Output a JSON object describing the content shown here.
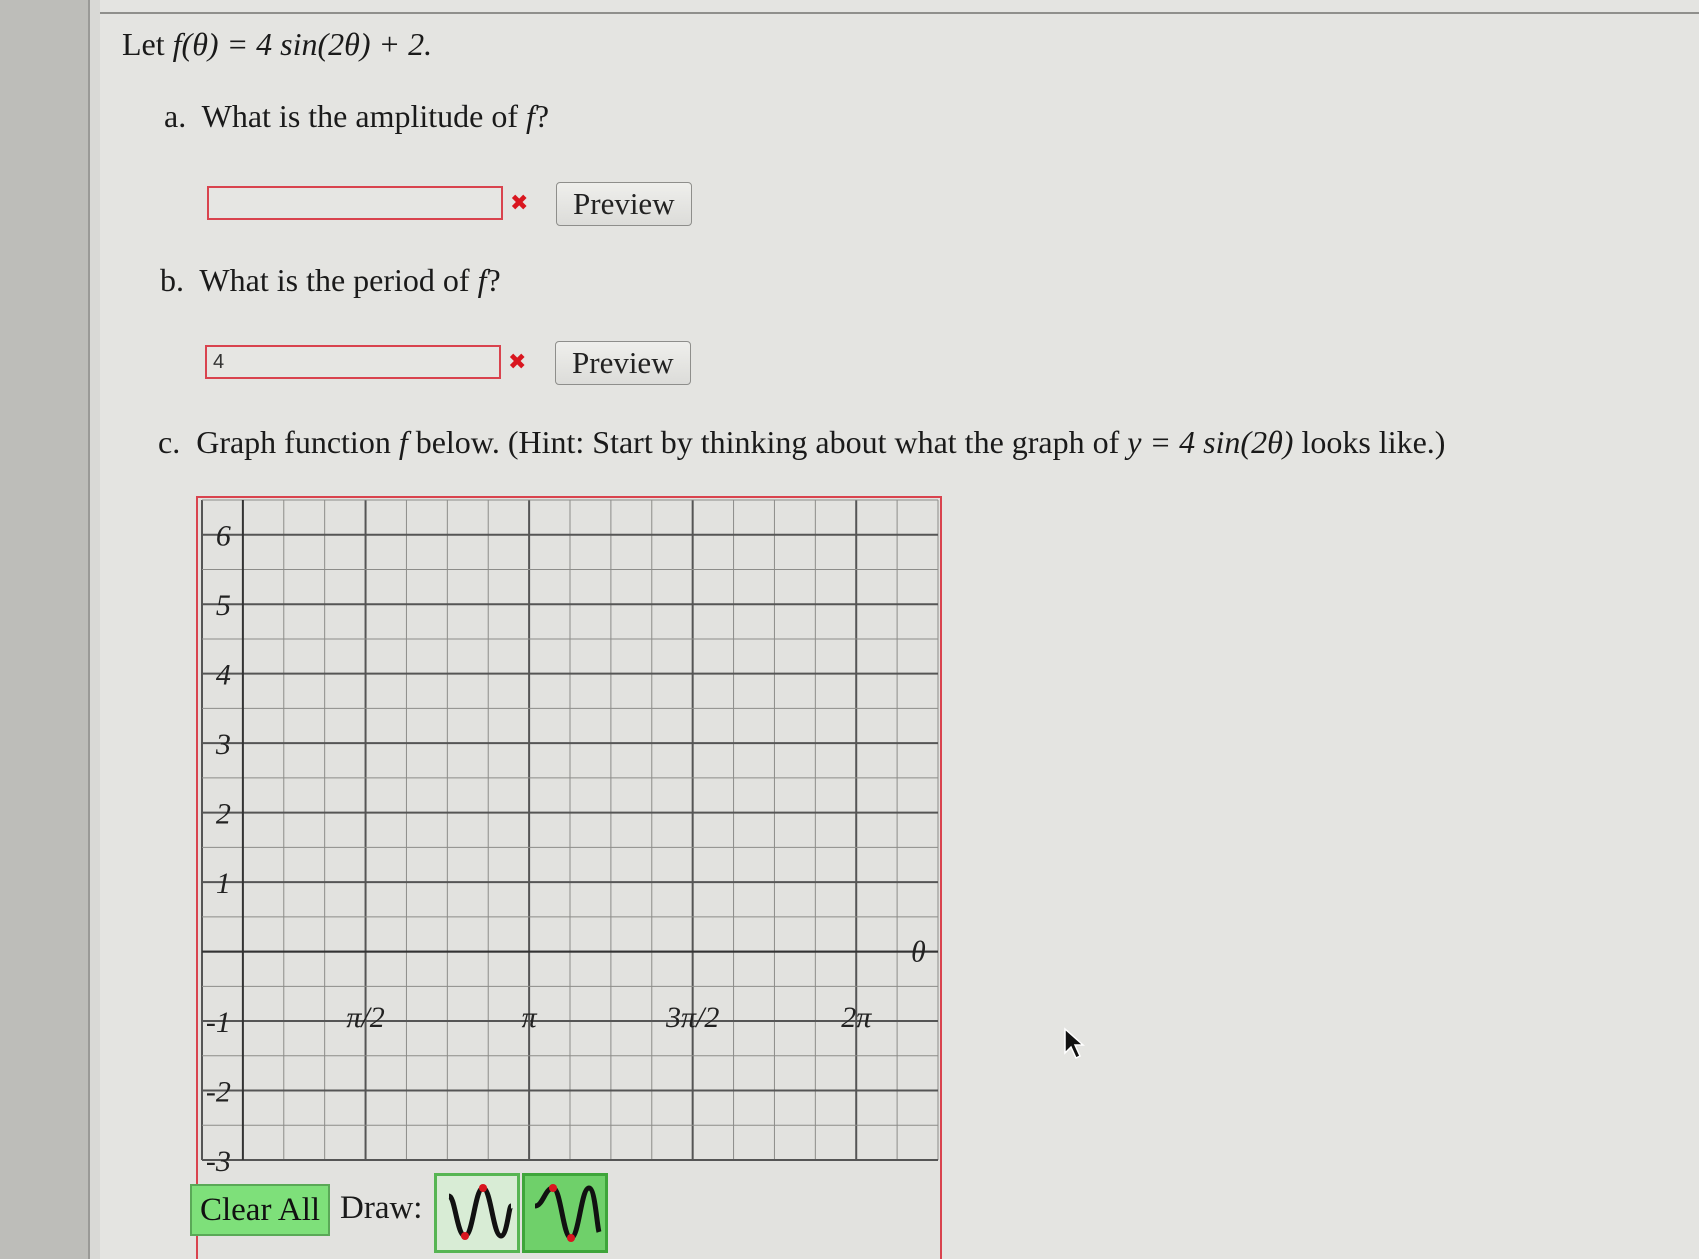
{
  "problem": {
    "intro_prefix": "Let",
    "intro_formula": "f(θ) = 4 sin(2θ) + 2."
  },
  "part_a": {
    "marker": "a.",
    "question": "What is the amplitude of",
    "var": "f",
    "qmark": "?",
    "answer_value": "",
    "status": "incorrect",
    "preview_label": "Preview"
  },
  "part_b": {
    "marker": "b.",
    "question": "What is the period of",
    "var": "f",
    "qmark": "?",
    "answer_value": "4",
    "status": "incorrect",
    "preview_label": "Preview"
  },
  "part_c": {
    "marker": "c.",
    "text_1": "Graph function",
    "var": "f",
    "text_2": "below. (Hint: Start by thinking about what the graph of",
    "hint_formula": "y = 4 sin(2θ)",
    "text_3": "looks like.)"
  },
  "graph": {
    "y_tick_labels": [
      "6",
      "5",
      "4",
      "3",
      "2",
      "1",
      "-1",
      "-2",
      "-3"
    ],
    "x_tick_labels": [
      "π/2",
      "π",
      "3π/2",
      "2π"
    ],
    "x_axis_label": "θ",
    "y_range": [
      -3,
      6.5
    ],
    "x_range_units_of_pi": [
      0,
      2.25
    ]
  },
  "controls": {
    "clear_label": "Clear All",
    "draw_label": "Draw:",
    "tools": [
      {
        "icon": "sine-wave-icon",
        "selected": true
      },
      {
        "icon": "sine-wave-icon",
        "selected": false
      }
    ]
  },
  "colors": {
    "error": "#d9434e",
    "button_green": "#7ee07a",
    "tool_border": "#3ea53a"
  }
}
